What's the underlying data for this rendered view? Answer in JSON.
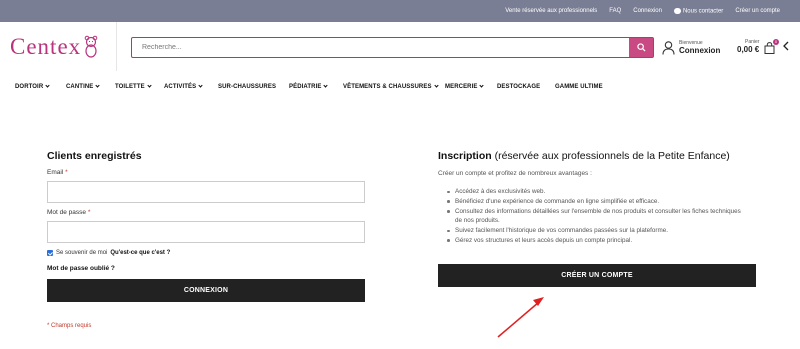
{
  "topbar": {
    "links": [
      "Vente réservée aux professionnels",
      "FAQ",
      "Connexion"
    ],
    "contact_label": "Nous contacter",
    "signup_label": "Créer un compte"
  },
  "logo": {
    "text": "Centex"
  },
  "search": {
    "placeholder": "Recherche...",
    "value": ""
  },
  "account": {
    "greeting": "Bienvenue",
    "label": "Connexion"
  },
  "cart": {
    "label": "Panier",
    "amount": "0,00 €",
    "count": "0"
  },
  "nav": {
    "items": [
      {
        "label": "DORTOIR",
        "dropdown": true
      },
      {
        "label": "CANTINE",
        "dropdown": true
      },
      {
        "label": "TOILETTE",
        "dropdown": true
      },
      {
        "label": "ACTIVITÉS",
        "dropdown": true
      },
      {
        "label": "SUR-CHAUSSURES",
        "dropdown": false
      },
      {
        "label": "PÉDIATRIE",
        "dropdown": true
      },
      {
        "label": "VÊTEMENTS & CHAUSSURES",
        "dropdown": true
      },
      {
        "label": "MERCERIE",
        "dropdown": true
      },
      {
        "label": "DESTOCKAGE",
        "dropdown": false
      },
      {
        "label": "GAMME ULTIME",
        "dropdown": false
      }
    ]
  },
  "login": {
    "title": "Clients enregistrés",
    "email_label": "Email",
    "password_label": "Mot de passe",
    "required_mark": "*",
    "remember_label": "Se souvenir de moi",
    "remember_help": "Qu'est-ce que c'est ?",
    "forgot_label": "Mot de passe oublié ?",
    "submit_label": "CONNEXION",
    "required_note": "* Champs requis"
  },
  "register": {
    "title": "Inscription",
    "subtitle": "(réservée aux professionnels de la Petite Enfance)",
    "intro": "Créer un compte et profitez de nombreux avantages :",
    "benefits": [
      "Accédez à des exclusivités web.",
      "Bénéficiez d'une expérience de commande en ligne simplifiée et efficace.",
      "Consultez des informations détaillées sur l'ensemble de nos produits et consulter les fiches techniques de nos produits.",
      "Suivez facilement l'historique de vos commandes passées sur la plateforme.",
      "Gérez vos structures et leurs accès depuis un compte principal."
    ],
    "button_label": "CRÉER UN COMPTE"
  },
  "colors": {
    "brand": "#b8347e",
    "topbar": "#7a7e94",
    "button": "#222222",
    "annotation_arrow": "#e02020"
  }
}
